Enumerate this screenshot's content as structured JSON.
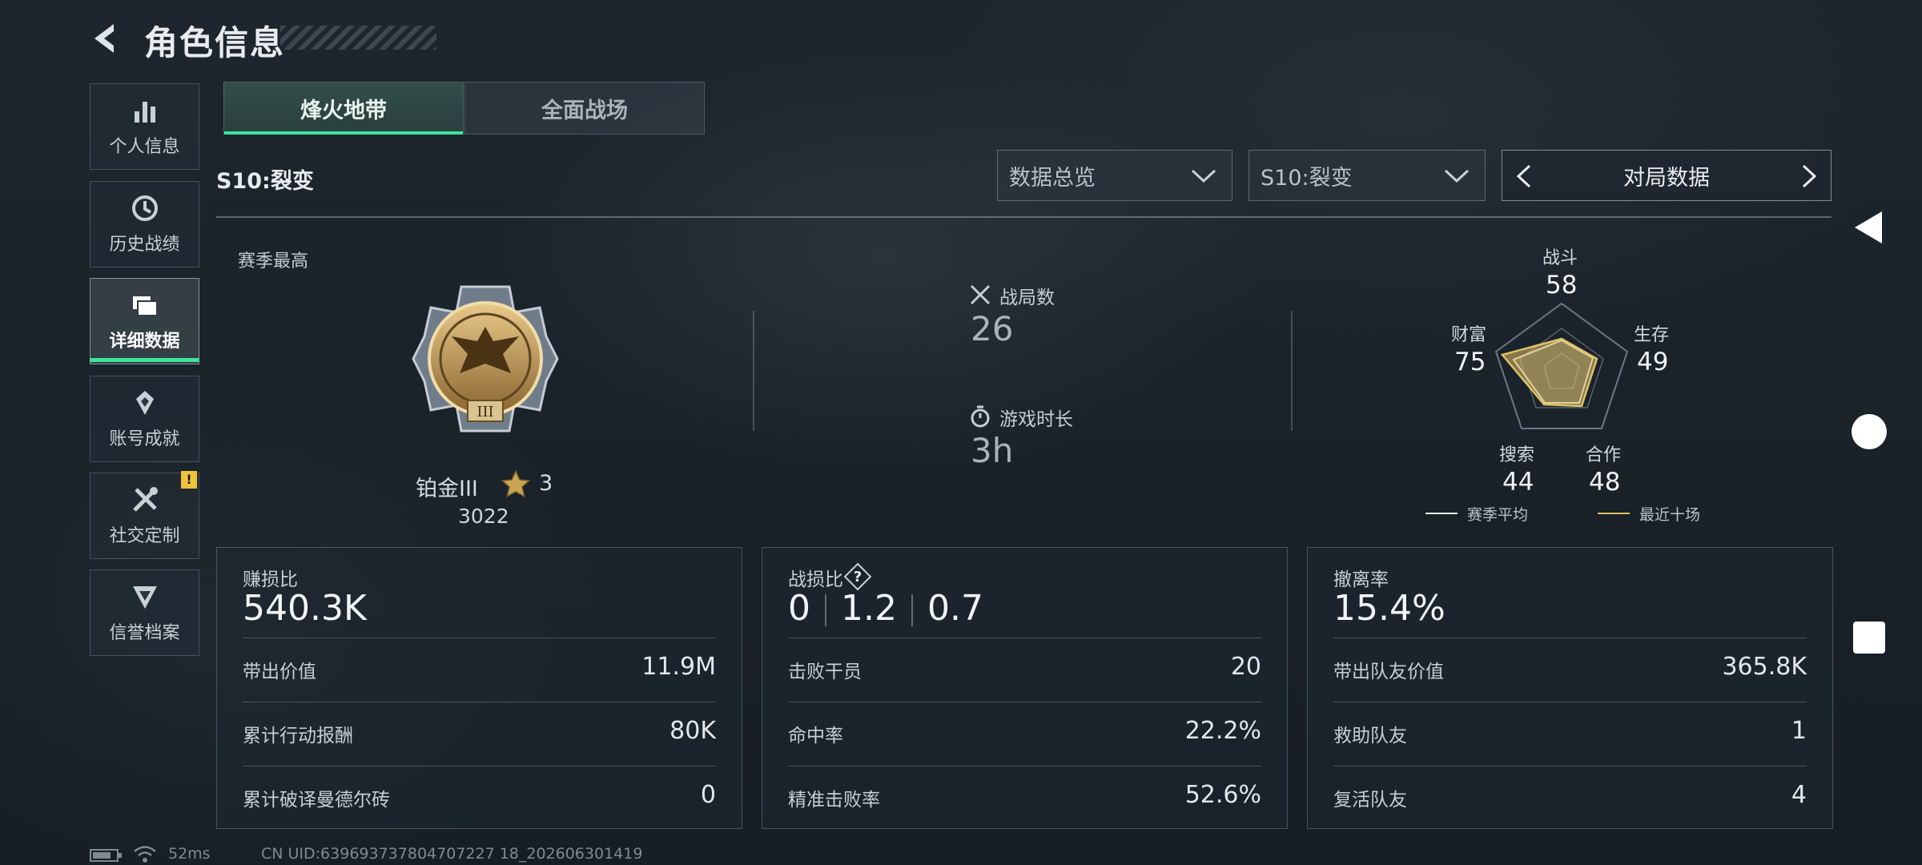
{
  "header": {
    "title": "角色信息"
  },
  "sidebar": {
    "items": [
      {
        "label": "个人信息",
        "icon": "bar-chart-icon"
      },
      {
        "label": "历史战绩",
        "icon": "history-icon"
      },
      {
        "label": "详细数据",
        "icon": "folder-icon",
        "active": true
      },
      {
        "label": "账号成就",
        "icon": "achievement-icon"
      },
      {
        "label": "社交定制",
        "icon": "tools-icon",
        "badge": "!"
      },
      {
        "label": "信誉档案",
        "icon": "shield-icon"
      }
    ]
  },
  "tabs": [
    {
      "label": "烽火地带",
      "active": true
    },
    {
      "label": "全面战场",
      "active": false
    }
  ],
  "season_label": "S10:裂变",
  "filters": {
    "data_type": "数据总览",
    "season": "S10:裂变",
    "pager_label": "对局数据"
  },
  "rank": {
    "section_label": "赛季最高",
    "name": "铂金III",
    "stars": "3",
    "score": "3022"
  },
  "match_stats": {
    "matches_label": "战局数",
    "matches_value": "26",
    "time_label": "游戏时长",
    "time_value": "3h"
  },
  "radar": {
    "axes": [
      {
        "label": "战斗",
        "value": "58"
      },
      {
        "label": "生存",
        "value": "49"
      },
      {
        "label": "合作",
        "value": "48"
      },
      {
        "label": "搜索",
        "value": "44"
      },
      {
        "label": "财富",
        "value": "75"
      }
    ],
    "legend": [
      {
        "label": "赛季平均",
        "color": "#e6ebef"
      },
      {
        "label": "最近十场",
        "color": "#e0c064"
      }
    ]
  },
  "panels": {
    "profit": {
      "title": "赚损比",
      "value": "540.3K",
      "rows": [
        {
          "label": "带出价值",
          "value": "11.9M"
        },
        {
          "label": "累计行动报酬",
          "value": "80K"
        },
        {
          "label": "累计破译曼德尔砖",
          "value": "0"
        }
      ]
    },
    "kd": {
      "title": "战损比",
      "values": [
        "0",
        "1.2",
        "0.7"
      ],
      "rows": [
        {
          "label": "击败干员",
          "value": "20"
        },
        {
          "label": "命中率",
          "value": "22.2%"
        },
        {
          "label": "精准击败率",
          "value": "52.6%"
        }
      ]
    },
    "extract": {
      "title": "撤离率",
      "value": "15.4%",
      "rows": [
        {
          "label": "带出队友价值",
          "value": "365.8K"
        },
        {
          "label": "救助队友",
          "value": "1"
        },
        {
          "label": "复活队友",
          "value": "4"
        }
      ]
    }
  },
  "footer": {
    "ping": "52ms",
    "uid": "CN UID:639693737804707227 18_202606301419"
  },
  "colors": {
    "accent": "#3ee39a",
    "badge": "#f0c33c",
    "radar_recent": "#e0c064"
  }
}
